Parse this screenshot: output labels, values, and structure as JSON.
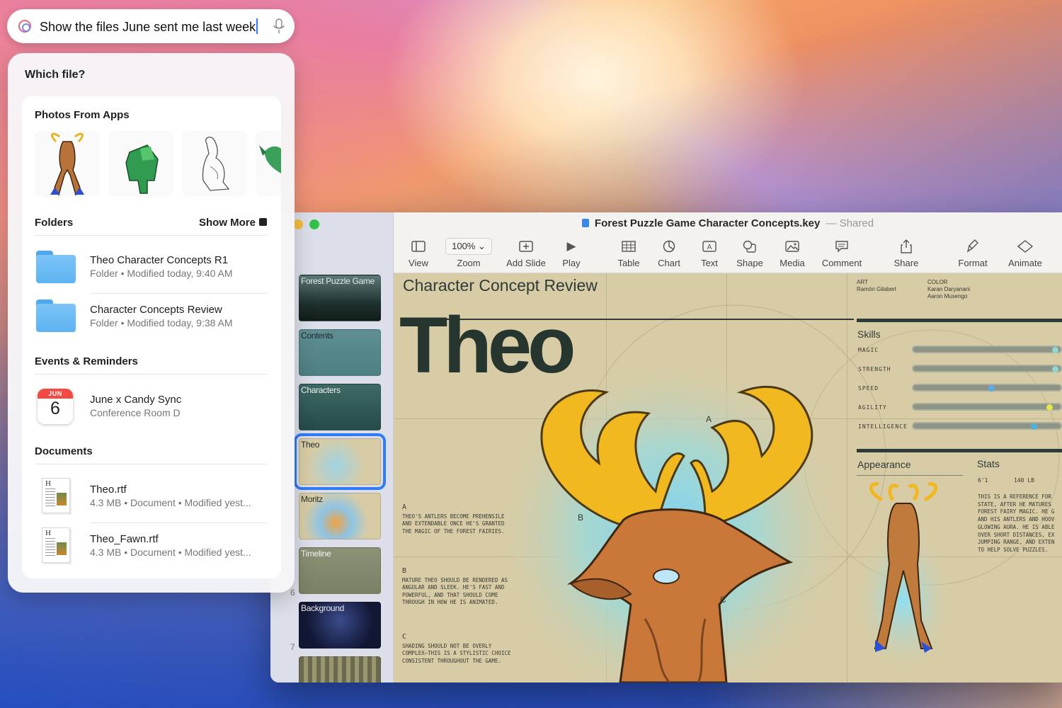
{
  "search": {
    "query": "Show the files June sent me last week"
  },
  "results": {
    "question": "Which file?",
    "photos_header": "Photos From Apps",
    "folders_header": "Folders",
    "show_more": "Show More",
    "folders": [
      {
        "name": "Theo Character Concepts R1",
        "meta": "Folder • Modified today, 9:40 AM"
      },
      {
        "name": "Character Concepts Review",
        "meta": "Folder • Modified today, 9:38 AM"
      }
    ],
    "events_header": "Events & Reminders",
    "event": {
      "month": "JUN",
      "day": "6",
      "title": "June x Candy Sync",
      "location": "Conference Room D"
    },
    "documents_header": "Documents",
    "documents": [
      {
        "name": "Theo.rtf",
        "meta": "4.3 MB • Document • Modified yest..."
      },
      {
        "name": "Theo_Fawn.rtf",
        "meta": "4.3 MB • Document • Modified yest..."
      }
    ]
  },
  "keynote": {
    "doc_title": "Forest Puzzle Game Character Concepts.key",
    "doc_status": "— Shared",
    "zoom_value": "100%",
    "toolbar": [
      "View",
      "Zoom",
      "Add Slide",
      "Play",
      "Table",
      "Chart",
      "Text",
      "Shape",
      "Media",
      "Comment",
      "Share",
      "Format",
      "Animate"
    ],
    "slides": [
      {
        "label": "Forest Puzzle Game"
      },
      {
        "label": "Contents"
      },
      {
        "label": "Characters"
      },
      {
        "label": "Theo"
      },
      {
        "label": "Moritz"
      },
      {
        "label": "Timeline"
      },
      {
        "label": "Background"
      },
      {
        "label": ""
      }
    ],
    "slide_numbers": [
      "6",
      "7"
    ],
    "canvas": {
      "title": "Character Concept Review",
      "big_name": "Theo",
      "credit_art_label": "ART",
      "credit_art": "Ramón Gilabert",
      "credit_color_label": "COLOR",
      "credit_color_1": "Karan Daryanani",
      "credit_color_2": "Aaron Musengo",
      "skills_header": "Skills",
      "skills": [
        {
          "name": "MAGIC",
          "level": 1.0
        },
        {
          "name": "STRENGTH",
          "level": 1.0
        },
        {
          "name": "SPEED",
          "level": 0.52
        },
        {
          "name": "AGILITY",
          "level": 0.93
        },
        {
          "name": "INTELLIGENCE",
          "level": 0.82
        }
      ],
      "appearance_header": "Appearance",
      "stats_header": "Stats",
      "height": "6'1",
      "weight": "140 LB",
      "stats_text": "THIS IS A REFERENCE FOR STATE, AFTER HE MATURES FOREST FAIRY MAGIC. HE G AND HIS ANTLERS AND HOOV GLOWING AURA. HE IS ABLE OVER SHORT DISTANCES, EX JUMPING RANGE, AND EXTEN TO HELP SOLVE PUZZLES.",
      "notes": [
        {
          "letter": "A",
          "text": "THEO'S ANTLERS BECOME PREHENSILE AND EXTENDABLE ONCE HE'S GRANTED THE MAGIC OF THE FOREST FAIRIES."
        },
        {
          "letter": "B",
          "text": "MATURE THEO SHOULD BE RENDERED AS ANGULAR AND SLEEK. HE'S FAST AND POWERFUL, AND THAT SHOULD COME THROUGH IN HOW HE IS ANIMATED."
        },
        {
          "letter": "C",
          "text": "SHADING SHOULD NOT BE OVERLY COMPLEX—THIS IS A STYLISTIC CHOICE CONSISTENT THROUGHOUT THE GAME."
        }
      ],
      "markers": [
        "A",
        "B",
        "C"
      ]
    }
  }
}
